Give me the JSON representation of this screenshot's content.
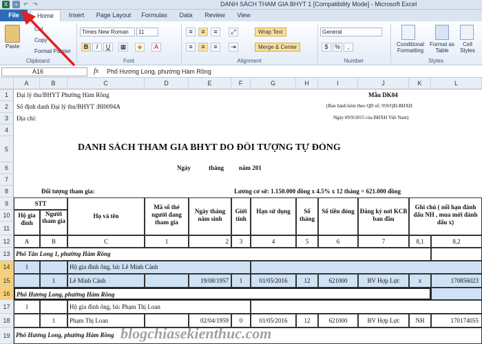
{
  "window": {
    "title": "DANH SÁCH THAM GIA BHYT 1 [Compatibility Mode] - Microsoft Excel"
  },
  "tabs": [
    "File",
    "Home",
    "Insert",
    "Page Layout",
    "Formulas",
    "Data",
    "Review",
    "View"
  ],
  "ribbon": {
    "clipboard": {
      "label": "Clipboard",
      "paste": "Paste",
      "cut": "Cut",
      "copy": "Copy",
      "format_painter": "Format Painter"
    },
    "font": {
      "label": "Font",
      "family": "Times New Roman",
      "size": "11",
      "bold": "B",
      "italic": "I",
      "underline": "U"
    },
    "alignment": {
      "label": "Alignment",
      "wrap": "Wrap Text",
      "merge": "Merge & Center"
    },
    "number": {
      "label": "Number",
      "format": "General"
    },
    "styles": {
      "label": "Styles",
      "conditional": "Conditional Formatting",
      "format_table": "Format as Table",
      "cell_styles": "Cell Styles"
    }
  },
  "formula_bar": {
    "name_box": "A16",
    "fx": "fx",
    "content": "Phố Hương Long, phường Hàm Rồng"
  },
  "columns": [
    "A",
    "B",
    "C",
    "D",
    "E",
    "F",
    "G",
    "H",
    "I",
    "J",
    "K",
    "L"
  ],
  "rows": [
    "1",
    "2",
    "3",
    "4",
    "5",
    "6",
    "7",
    "8",
    "9",
    "10",
    "11",
    "12",
    "13",
    "14",
    "15",
    "16",
    "17",
    "18",
    "19"
  ],
  "sheet": {
    "r1a": "Đại lý thu/BHYT Phường Hàm Rồng",
    "r1b": "Mẫu DK04",
    "r2a": "Số định danh Đại lý thu/BHYT :BI0094A",
    "r2b": "(Ban hành kèm theo QĐ số: 959/QĐ-BHXH",
    "r3a": "Địa chỉ:",
    "r3b": "Ngày 09/9/2015 của BHXH Việt Nam)",
    "title": "DANH SÁCH THAM GIA BHYT DO ĐỐI TƯỢNG TỰ ĐÓNG",
    "date_ngay": "Ngày",
    "date_thang": "tháng",
    "date_nam": "năm 201",
    "r8a": "Đối tượng tham gia:",
    "r8b": "Lương cơ sở: 1.150.000 đồng x 4.5% x 12 tháng = 621.000 đồng",
    "h_stt": "STT",
    "h_hogd": "Hộ gia đình",
    "h_nguoi": "Người tham gia",
    "h_hoten": "Họ và tên",
    "h_maso": "Mã số thẻ người đang tham gia",
    "h_ngaysinh": "Ngày tháng năm sinh",
    "h_gioitinh": "Giới tính",
    "h_hansd": "Hạn sử dụng",
    "h_sothang": "Số tháng",
    "h_sotien": "Số tiền đóng",
    "h_kcb": "Đăng ký nơi KCB ban đầu",
    "h_ghichu": "Ghi chú ( nối hạn đánh dấu NH , mua mới đánh dấu x)",
    "idx": [
      "A",
      "B",
      "C",
      "1",
      "2",
      "3",
      "4",
      "5",
      "6",
      "7",
      "8,1",
      "8,2"
    ],
    "g1": "Phố Tân Long 1, phường Hàm Rồng",
    "r14a": "1",
    "r14c": "Hộ gia đình ông, bà: Lê Minh Cảnh",
    "r15": {
      "b": "1",
      "c": "Lê Minh Cảnh",
      "e": "19/08/1957",
      "f": "1",
      "g": "01/05/2016",
      "h": "12",
      "i": "621000",
      "j": "BV Hợp Lực",
      "k": "x",
      "l": "170856023"
    },
    "g2": "Phố Hương Long, phường Hàm Rồng",
    "r17a": "1",
    "r17c": "Hộ gia đình ông, bà: Phạm Thị Loan",
    "r18": {
      "b": "1",
      "c": "Phạm Thị Loan",
      "e": "02/04/1959",
      "f": "0",
      "g": "01/05/2016",
      "h": "12",
      "i": "621000",
      "j": "BV Hợp Lực",
      "k": "NH",
      "l": "170174055"
    },
    "g3": "Phố Hương Long, phường Hàm Rồng"
  },
  "watermark": "blogchiasekienthuc.com"
}
